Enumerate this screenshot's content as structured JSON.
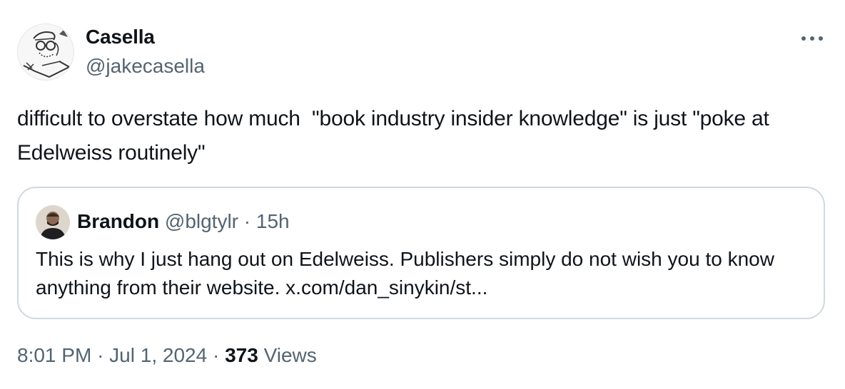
{
  "tweet": {
    "author": {
      "display_name": "Casella",
      "handle": "@jakecasella",
      "avatar_icon": "sketch-avatar"
    },
    "more_icon": "more-horizontal-icon",
    "text": "difficult to overstate how much  \"book industry insider knowledge\" is just \"poke at Edelweiss routinely\"",
    "quote": {
      "display_name": "Brandon",
      "handle": "@blgtylr",
      "separator": "·",
      "time": "15h",
      "text": "This is why I just hang out on Edelweiss. Publishers simply do not wish you to know anything from their website. x.com/dan_sinykin/st..."
    },
    "meta": {
      "time": "8:01 PM",
      "separator1": "·",
      "date": "Jul 1, 2024",
      "separator2": "·",
      "views_count": "373",
      "views_label": "Views"
    }
  },
  "colors": {
    "text_primary": "#0f1419",
    "text_secondary": "#536471",
    "border": "#cfd9de"
  }
}
